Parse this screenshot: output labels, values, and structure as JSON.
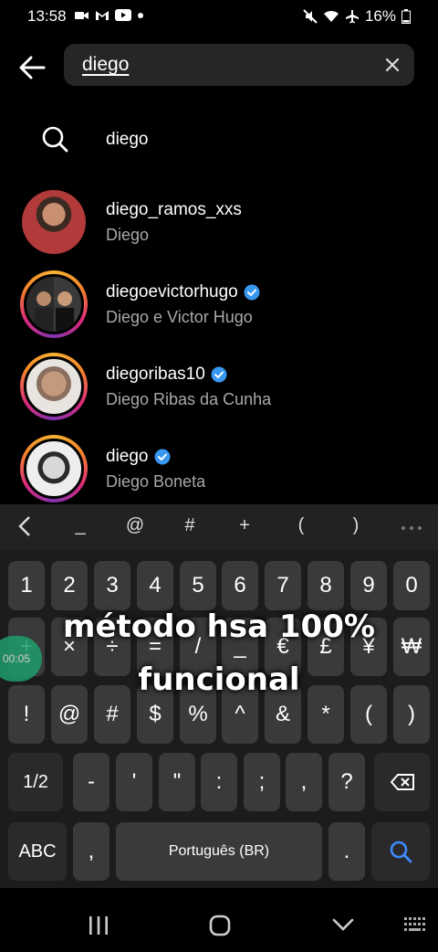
{
  "status_bar": {
    "time": "13:58",
    "battery": "16%"
  },
  "search": {
    "query": "diego"
  },
  "suggestion": {
    "text": "diego"
  },
  "results": [
    {
      "username": "diego_ramos_xxs",
      "full_name": "Diego",
      "verified": false,
      "has_story": false
    },
    {
      "username": "diegoevictorhugo",
      "full_name": "Diego e Victor Hugo",
      "verified": true,
      "has_story": true
    },
    {
      "username": "diegoribas10",
      "full_name": "Diego Ribas da Cunha",
      "verified": true,
      "has_story": true
    },
    {
      "username": "diego",
      "full_name": "Diego Boneta",
      "verified": true,
      "has_story": true
    }
  ],
  "keyboard": {
    "toolbar": [
      "_",
      "@",
      "#",
      "+",
      "(",
      ")"
    ],
    "row1": [
      "1",
      "2",
      "3",
      "4",
      "5",
      "6",
      "7",
      "8",
      "9",
      "0"
    ],
    "row2": [
      "+",
      "×",
      "÷",
      "=",
      "/",
      "_",
      "€",
      "£",
      "¥",
      "₩"
    ],
    "row3": [
      "!",
      "@",
      "#",
      "$",
      "%",
      "^",
      "&",
      "*",
      "(",
      ")"
    ],
    "row4_mode": "1/2",
    "row4": [
      "-",
      "'",
      "\"",
      ":",
      ";",
      ",",
      "?"
    ],
    "row5_mode": "ABC",
    "row5_comma": ",",
    "space_label": "Português (BR)",
    "row5_period": "."
  },
  "overlay": {
    "line1": "método hsa 100%",
    "line2": "funcional",
    "timer": "00:05"
  },
  "colors": {
    "verified": "#3897f0",
    "search_key": "#3d8bfd"
  }
}
